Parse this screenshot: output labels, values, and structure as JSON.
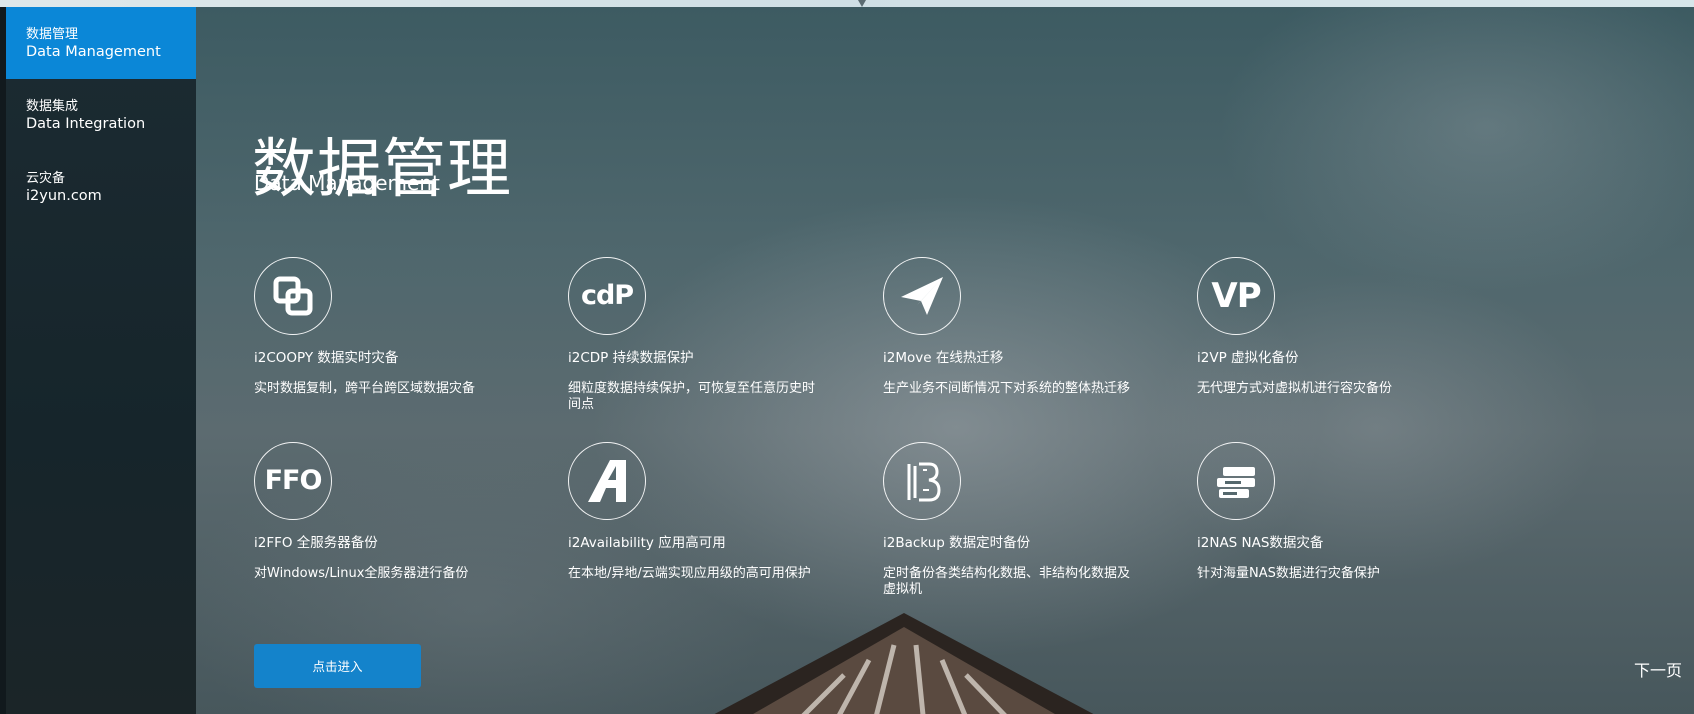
{
  "sidebar": {
    "items": [
      {
        "cn": "数据管理",
        "en": "Data Management"
      },
      {
        "cn": "数据集成",
        "en": "Data Integration"
      },
      {
        "cn": "云灾备",
        "en": "i2yun.com"
      }
    ]
  },
  "hero": {
    "title_cn": "数据管理",
    "title_en": "Data Management"
  },
  "products": [
    {
      "icon": "linked-squares-icon",
      "name": "i2COOPY 数据实时灾备",
      "desc": "实时数据复制，跨平台跨区域数据灾备"
    },
    {
      "icon": "cdp-icon",
      "icon_text": "cdP",
      "name": "i2CDP 持续数据保护",
      "desc": "细粒度数据持续保护，可恢复至任意历史时间点"
    },
    {
      "icon": "paper-plane-icon",
      "name": "i2Move 在线热迁移",
      "desc": "生产业务不间断情况下对系统的整体热迁移"
    },
    {
      "icon": "vp-icon",
      "icon_text": "VP",
      "name": "i2VP 虚拟化备份",
      "desc": "无代理方式对虚拟机进行容灾备份"
    },
    {
      "icon": "ffo-icon",
      "icon_text": "FFO",
      "name": "i2FFO 全服务器备份",
      "desc": "对Windows/Linux全服务器进行备份"
    },
    {
      "icon": "availability-a-icon",
      "name": "i2Availability 应用高可用",
      "desc": "在本地/异地/云端实现应用级的高可用保护"
    },
    {
      "icon": "backup-b-icon",
      "name": "i2Backup 数据定时备份",
      "desc": "定时备份各类结构化数据、非结构化数据及虚拟机"
    },
    {
      "icon": "nas-storage-icon",
      "name": "i2NAS NAS数据灾备",
      "desc": "针对海量NAS数据进行灾备保护"
    }
  ],
  "actions": {
    "enter_label": "点击进入",
    "next_label": "下一页"
  },
  "colors": {
    "accent": "#0b87d7",
    "button": "#1483cb",
    "sidebar_bg": "#1c2b32"
  }
}
